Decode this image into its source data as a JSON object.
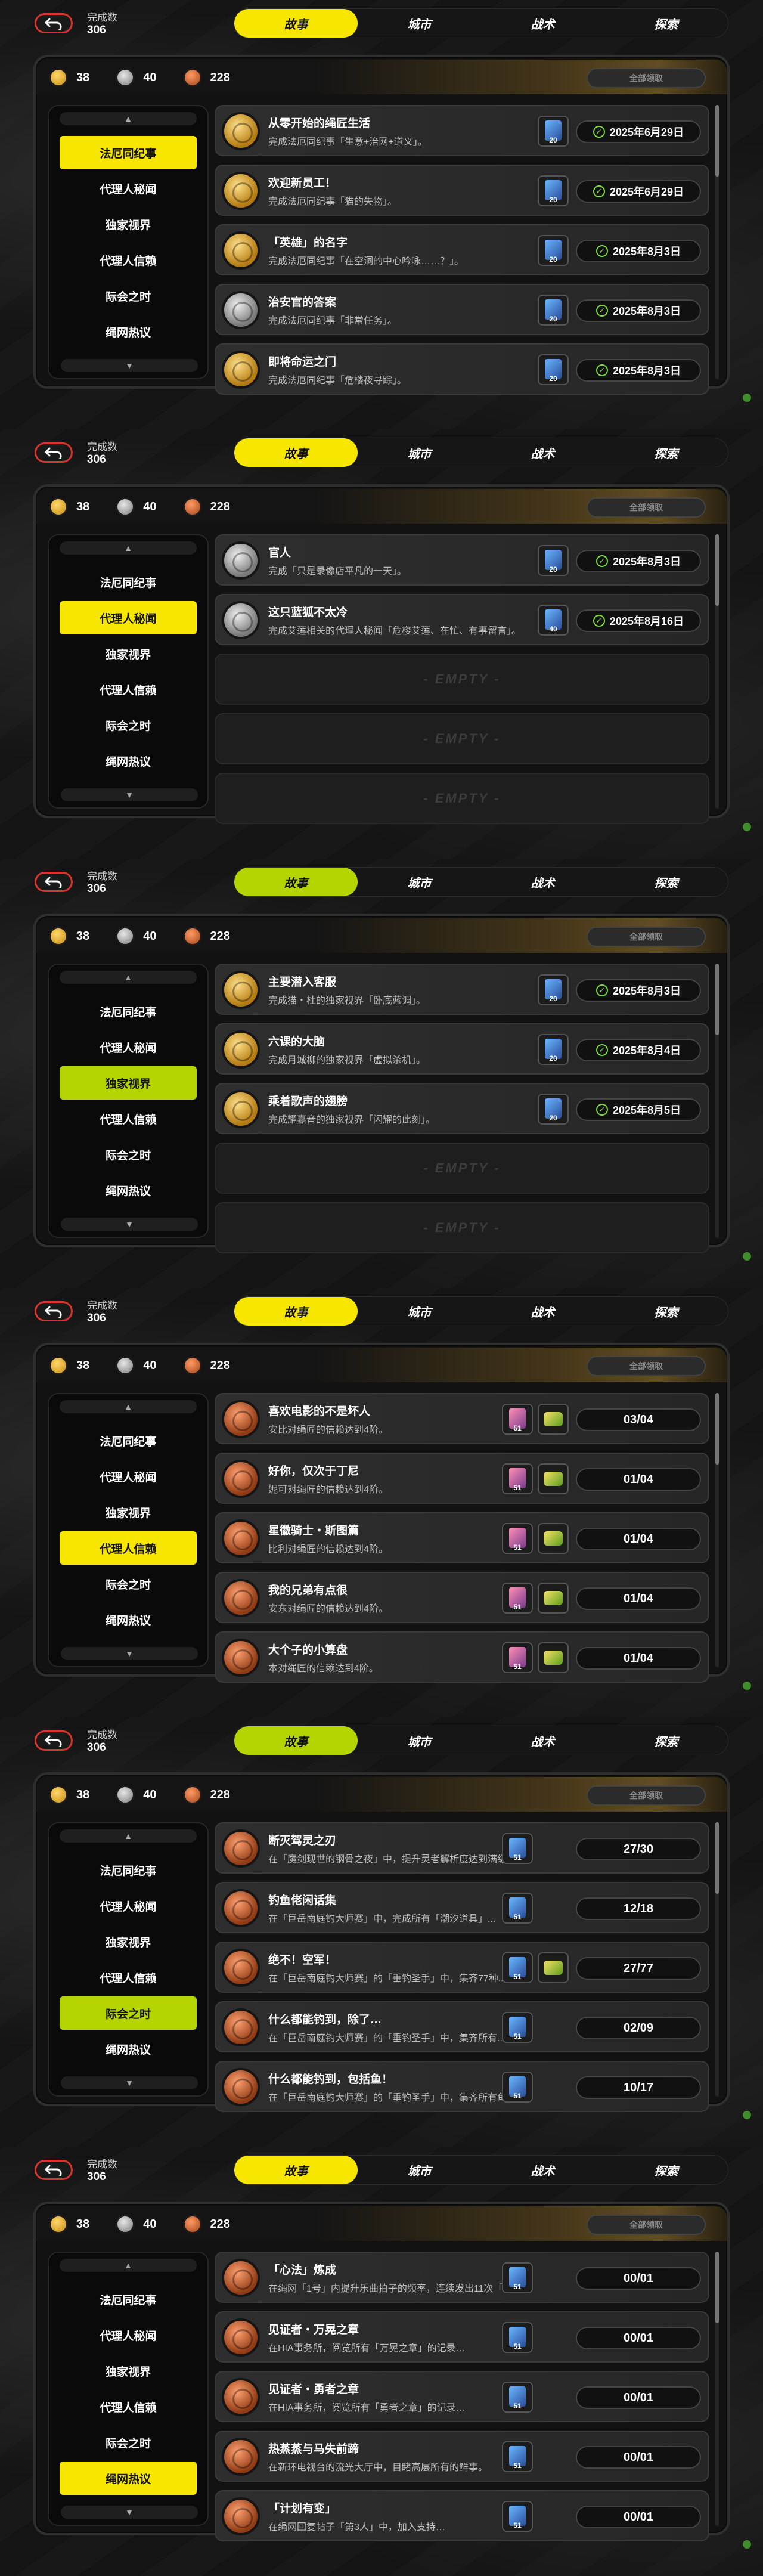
{
  "common": {
    "completion_label": "完成数",
    "completion_value": "306",
    "tabs": [
      "故事",
      "城市",
      "战术",
      "探索"
    ],
    "currency": [
      {
        "icon": "gold-coin-icon",
        "value": "38"
      },
      {
        "icon": "silver-coin-icon",
        "value": "40"
      },
      {
        "icon": "bronze-coin-icon",
        "value": "228"
      }
    ],
    "claim_all": "全部领取",
    "empty_label": "- EMPTY -",
    "sidebar": [
      "法厄同纪事",
      "代理人秘闻",
      "独家视界",
      "代理人信赖",
      "际会之时",
      "绳网热议"
    ],
    "colors": {
      "yellow": "#f6e600",
      "lime": "#b5d400"
    }
  },
  "panels": [
    {
      "accent": "#f6e600",
      "active_sidebar": 0,
      "rows": [
        {
          "medal": "gold",
          "title": "从零开始的绳匠生活",
          "desc": "完成法厄同纪事「生意+治网+道义」。",
          "reward": "20",
          "date": "2025年6月29日"
        },
        {
          "medal": "gold",
          "title": "欢迎新员工！",
          "desc": "完成法厄同纪事「猫的失物」。",
          "reward": "20",
          "date": "2025年6月29日"
        },
        {
          "medal": "gold",
          "title": "「英雄」的名字",
          "desc": "完成法厄同纪事「在空洞的中心吟咏……？」。",
          "reward": "20",
          "date": "2025年8月3日"
        },
        {
          "medal": "silver",
          "title": "治安官的答案",
          "desc": "完成法厄同纪事「非常任务」。",
          "reward": "20",
          "date": "2025年8月3日"
        },
        {
          "medal": "gold",
          "title": "即将命运之门",
          "desc": "完成法厄同纪事「危楼夜寻踪」。",
          "reward": "20",
          "date": "2025年8月3日"
        }
      ],
      "empties": 0
    },
    {
      "accent": "#f6e600",
      "active_sidebar": 1,
      "rows": [
        {
          "medal": "silver",
          "title": "官人",
          "desc": "完成「只是录像店平凡的一天」。",
          "reward": "20",
          "date": "2025年8月3日"
        },
        {
          "medal": "silver",
          "title": "这只蓝狐不太冷",
          "desc": "完成艾莲相关的代理人秘闻「危楼艾莲、在忙、有事留言」。",
          "reward": "40",
          "date": "2025年8月16日"
        }
      ],
      "empties": 3
    },
    {
      "accent": "#b5d400",
      "active_sidebar": 2,
      "rows": [
        {
          "medal": "gold",
          "title": "主要潜入客服",
          "desc": "完成猫・杜的独家视界「卧底蓝调」。",
          "reward": "20",
          "date": "2025年8月3日"
        },
        {
          "medal": "gold",
          "title": "六课的大脑",
          "desc": "完成月城柳的独家视界「虚拟杀机」。",
          "reward": "20",
          "date": "2025年8月4日"
        },
        {
          "medal": "gold",
          "title": "乘着歌声的翅膀",
          "desc": "完成耀嘉音的独家视界「闪耀的此刻」。",
          "reward": "20",
          "date": "2025年8月5日"
        }
      ],
      "empties": 2
    },
    {
      "accent": "#f6e600",
      "active_sidebar": 3,
      "rows": [
        {
          "medal": "bronze",
          "title": "喜欢电影的不是坏人",
          "desc": "安比对绳匠的信赖达到4阶。",
          "reward": "51",
          "progress": "03/04"
        },
        {
          "medal": "bronze",
          "title": "好你，仅次于丁尼",
          "desc": "妮可对绳匠的信赖达到4阶。",
          "reward": "51",
          "progress": "01/04"
        },
        {
          "medal": "bronze",
          "title": "星徽骑士・斯图篇",
          "desc": "比利对绳匠的信赖达到4阶。",
          "reward": "51",
          "progress": "01/04"
        },
        {
          "medal": "bronze",
          "title": "我的兄弟有点很",
          "desc": "安东对绳匠的信赖达到4阶。",
          "reward": "51",
          "progress": "01/04"
        },
        {
          "medal": "bronze",
          "title": "大个子的小算盘",
          "desc": "本对绳匠的信赖达到4阶。",
          "reward": "51",
          "progress": "01/04"
        }
      ],
      "empties": 0,
      "pink": true
    },
    {
      "accent": "#b5d400",
      "active_sidebar": 4,
      "rows": [
        {
          "medal": "bronze",
          "title": "断灭驾灵之刃",
          "desc": "在「魔剑现世的钢骨之夜」中，提升灵者解析度达到满级...",
          "reward": "51",
          "progress": "27/30"
        },
        {
          "medal": "bronze",
          "title": "钓鱼佬闲话集",
          "desc": "在「巨岳南庭钓大师赛」中，完成所有「潮汐道具」...",
          "reward": "51",
          "progress": "12/18"
        },
        {
          "medal": "bronze",
          "title": "绝不！空军！",
          "desc": "在「巨岳南庭钓大师赛」的「垂钓圣手」中，集齐77种...",
          "reward": "51",
          "progress": "27/77"
        },
        {
          "medal": "bronze",
          "title": "什么都能钓到，除了…",
          "desc": "在「巨岳南庭钓大师赛」的「垂钓圣手」中，集齐所有...",
          "reward": "51",
          "progress": "02/09"
        },
        {
          "medal": "bronze",
          "title": "什么都能钓到，包括鱼！",
          "desc": "在「巨岳南庭钓大师赛」的「垂钓圣手」中，集齐所有鱼类。",
          "reward": "51",
          "progress": "10/17"
        }
      ],
      "empties": 0
    },
    {
      "accent": "#f6e600",
      "active_sidebar": 5,
      "rows": [
        {
          "medal": "bronze",
          "title": "「心法」炼成",
          "desc": "在绳网「1号」内提升乐曲拍子的频率，连续发出11次「心法」…",
          "reward": "51",
          "progress": "00/01"
        },
        {
          "medal": "bronze",
          "title": "见证者・万晃之章",
          "desc": "在HIA事务所，阅览所有「万晃之章」的记录…",
          "reward": "51",
          "progress": "00/01"
        },
        {
          "medal": "bronze",
          "title": "见证者・勇者之章",
          "desc": "在HIA事务所，阅览所有「勇者之章」的记录…",
          "reward": "51",
          "progress": "00/01"
        },
        {
          "medal": "bronze",
          "title": "热蒸蒸与马失前蹄",
          "desc": "在新环电视台的流光大厅中，目睹高层所有的鲜事。",
          "reward": "51",
          "progress": "00/01"
        },
        {
          "medal": "bronze",
          "title": "「计划有变」",
          "desc": "在绳网回复帖子「第3人」中，加入支持…",
          "reward": "51",
          "progress": "00/01"
        }
      ],
      "empties": 0
    }
  ]
}
